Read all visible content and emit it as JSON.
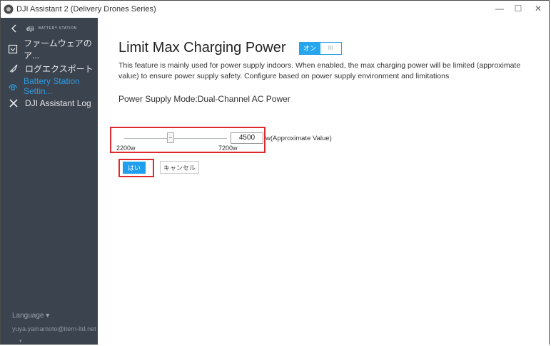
{
  "window": {
    "title": "DJI Assistant 2 (Delivery Drones Series)",
    "controls": {
      "minimize": "—",
      "maximize": "☐",
      "close": "✕"
    }
  },
  "sidebar": {
    "brand": {
      "logo": "dji",
      "subtitle": "BATTERY STATION"
    },
    "items": [
      {
        "label": "ファームウェアのア...",
        "icon": "firmware-icon"
      },
      {
        "label": "ログエクスポート",
        "icon": "rocket-icon"
      },
      {
        "label": "Battery Station Settin...",
        "icon": "battery-station-icon",
        "active": true
      },
      {
        "label": "DJI Assistant Log",
        "icon": "tools-icon"
      }
    ],
    "footer": {
      "language": "Language ▾",
      "email": "yuya.yamamoto@itern-ltd.net",
      "caret": "▾"
    }
  },
  "main": {
    "title": "Limit Max Charging Power",
    "toggle": {
      "on_label": "オン",
      "off_label": "III",
      "state": "on"
    },
    "description": "This feature is mainly used for power supply indoors. When enabled, the max charging power will be limited (approximate value) to ensure power supply safety. Configure based on power supply environment and limitations",
    "mode": "Power Supply Mode:Dual-Channel AC Power",
    "slider": {
      "min_label": "2200w",
      "max_label": "7200w",
      "min": 2200,
      "max": 7200,
      "value": 4500,
      "unit_label": "w(Approximate Value)"
    },
    "buttons": {
      "confirm": "はい",
      "cancel": "キャンセル"
    }
  },
  "colors": {
    "sidebar_bg": "#3b434e",
    "accent": "#25a7f0",
    "highlight_box": "#e0292c"
  }
}
